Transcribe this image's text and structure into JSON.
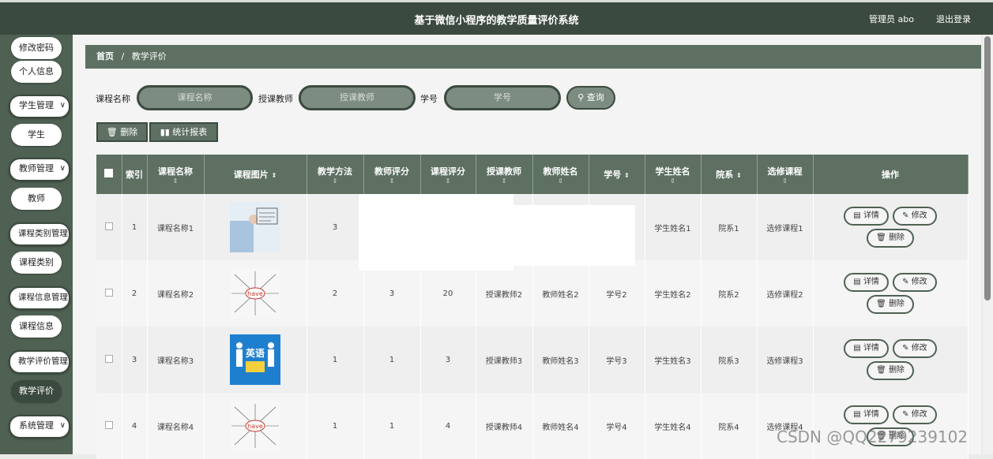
{
  "app": {
    "title": "基于微信小程序的教学质量评价系统",
    "user_label": "管理员 abo",
    "logout_label": "退出登录"
  },
  "sidebar": {
    "items": [
      {
        "label": "修改密码"
      },
      {
        "label": "个人信息"
      },
      {
        "label": "学生管理"
      },
      {
        "label": "学生"
      },
      {
        "label": "教师管理"
      },
      {
        "label": "教师"
      },
      {
        "label": "课程类别管理"
      },
      {
        "label": "课程类别"
      },
      {
        "label": "课程信息管理"
      },
      {
        "label": "课程信息"
      },
      {
        "label": "教学评价管理"
      },
      {
        "label": "教学评价"
      },
      {
        "label": "系统管理"
      }
    ]
  },
  "breadcrumb": {
    "home": "首页",
    "separator": "/",
    "current": "教学评价"
  },
  "search": {
    "course_label": "课程名称",
    "course_placeholder": "课程名称",
    "teacher_label": "授课教师",
    "teacher_placeholder": "授课教师",
    "student_no_label": "学号",
    "student_no_placeholder": "学号",
    "query_label": "查询"
  },
  "toolbar": {
    "delete_label": "删除",
    "report_label": "统计报表"
  },
  "table": {
    "headers": {
      "index": "索引",
      "course_name": "课程名称",
      "course_image": "课程图片",
      "method": "教学方法",
      "teacher_score": "教师评分",
      "course_score": "课程评分",
      "teacher": "授课教师",
      "teacher_name": "教师姓名",
      "student_no": "学号",
      "student_name": "学生姓名",
      "department": "院系",
      "elective": "选修课程",
      "actions": "操作"
    },
    "rows": [
      {
        "index": "1",
        "course_name": "课程名称1",
        "method": "3",
        "teacher_score": "",
        "course_score": "",
        "teacher": "",
        "teacher_name": "",
        "student_no": "",
        "student_name": "学生姓名1",
        "department": "院系1",
        "elective": "选修课程1"
      },
      {
        "index": "2",
        "course_name": "课程名称2",
        "method": "2",
        "teacher_score": "3",
        "course_score": "20",
        "teacher": "授课教师2",
        "teacher_name": "教师姓名2",
        "student_no": "学号2",
        "student_name": "学生姓名2",
        "department": "院系2",
        "elective": "选修课程2"
      },
      {
        "index": "3",
        "course_name": "课程名称3",
        "method": "1",
        "teacher_score": "1",
        "course_score": "3",
        "teacher": "授课教师3",
        "teacher_name": "教师姓名3",
        "student_no": "学号3",
        "student_name": "学生姓名3",
        "department": "院系3",
        "elective": "选修课程3"
      },
      {
        "index": "4",
        "course_name": "课程名称4",
        "method": "1",
        "teacher_score": "1",
        "course_score": "4",
        "teacher": "授课教师4",
        "teacher_name": "教师姓名4",
        "student_no": "学号4",
        "student_name": "学生姓名4",
        "department": "院系4",
        "elective": "选修课程4"
      }
    ],
    "actions": {
      "detail": "详情",
      "edit": "修改",
      "delete": "删除"
    },
    "image_texts": [
      "have",
      "英语",
      "have"
    ]
  },
  "watermark": "CSDN @QQ2279239102",
  "colors": {
    "primary": "#3b4a3f",
    "header": "#5d7062",
    "sidebar": "#4f6153"
  }
}
